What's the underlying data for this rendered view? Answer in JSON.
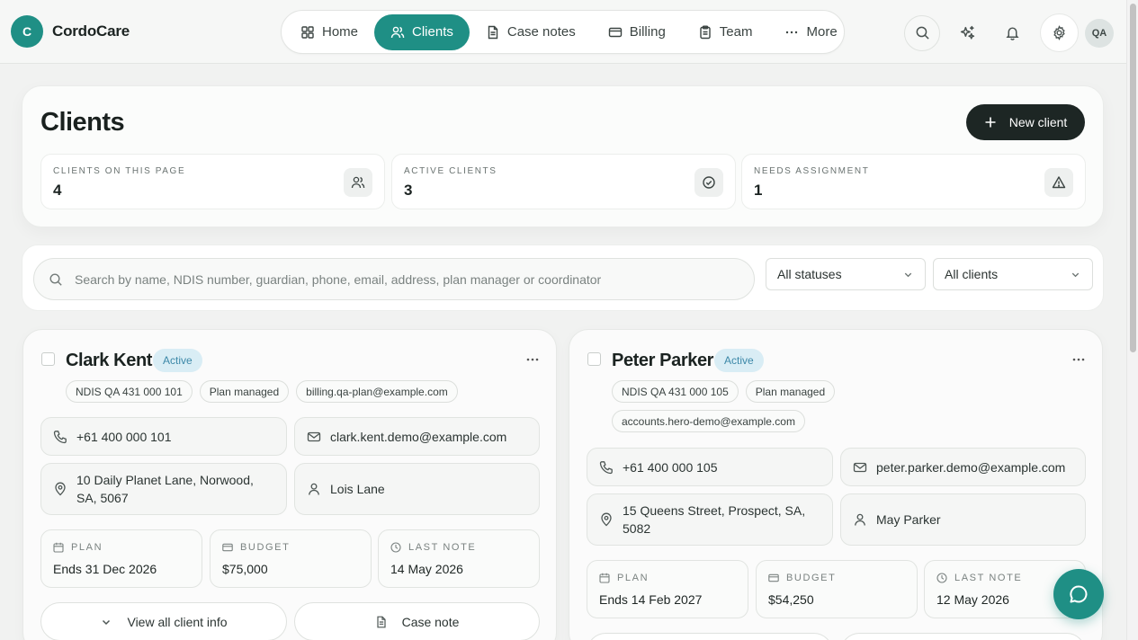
{
  "brand": {
    "logo_letter": "C",
    "name": "CordoCare"
  },
  "nav": {
    "items": [
      {
        "label": "Home",
        "icon": "grid-icon"
      },
      {
        "label": "Clients",
        "icon": "users-icon",
        "active": true
      },
      {
        "label": "Case notes",
        "icon": "document-icon"
      },
      {
        "label": "Billing",
        "icon": "card-icon"
      },
      {
        "label": "Team",
        "icon": "clipboard-icon"
      },
      {
        "label": "More",
        "icon": "dots-icon"
      }
    ]
  },
  "topbar": {
    "icons": [
      "search-icon",
      "sparkles-icon",
      "bell-icon",
      "gear-icon"
    ],
    "avatar_initials": "QA"
  },
  "header": {
    "title": "Clients",
    "new_client_label": "New client",
    "stats": [
      {
        "label": "CLIENTS ON THIS PAGE",
        "value": "4",
        "icon": "users-icon"
      },
      {
        "label": "ACTIVE CLIENTS",
        "value": "3",
        "icon": "check-circle-icon"
      },
      {
        "label": "NEEDS ASSIGNMENT",
        "value": "1",
        "icon": "warning-icon"
      }
    ]
  },
  "filters": {
    "search_placeholder": "Search by name, NDIS number, guardian, phone, email, address, plan manager or coordinator",
    "status_select": "All statuses",
    "client_select": "All clients"
  },
  "clients": [
    {
      "name": "Clark Kent",
      "status": "Active",
      "tags": [
        "NDIS QA 431 000 101",
        "Plan managed",
        "billing.qa-plan@example.com"
      ],
      "phone": "+61 400 000 101",
      "email": "clark.kent.demo@example.com",
      "address": "10 Daily Planet Lane, Norwood, SA, 5067",
      "guardian": "Lois Lane",
      "plan_label": "PLAN",
      "plan_value": "Ends 31 Dec 2026",
      "budget_label": "BUDGET",
      "budget_value": "$75,000",
      "last_note_label": "LAST NOTE",
      "last_note_value": "14 May 2026",
      "view_label": "View all client info",
      "case_note_label": "Case note"
    },
    {
      "name": "Peter Parker",
      "status": "Active",
      "tags": [
        "NDIS QA 431 000 105",
        "Plan managed",
        "accounts.hero-demo@example.com"
      ],
      "phone": "+61 400 000 105",
      "email": "peter.parker.demo@example.com",
      "address": "15 Queens Street, Prospect, SA, 5082",
      "guardian": "May Parker",
      "plan_label": "PLAN",
      "plan_value": "Ends 14 Feb 2027",
      "budget_label": "BUDGET",
      "budget_value": "$54,250",
      "last_note_label": "LAST NOTE",
      "last_note_value": "12 May 2026"
    }
  ],
  "colors": {
    "accent": "#1f8f85",
    "dark_button": "#1d2624",
    "status_badge_bg": "#d9edf5",
    "status_badge_text": "#3c88a8"
  },
  "chat": {
    "icon": "chat-bubble-icon"
  }
}
